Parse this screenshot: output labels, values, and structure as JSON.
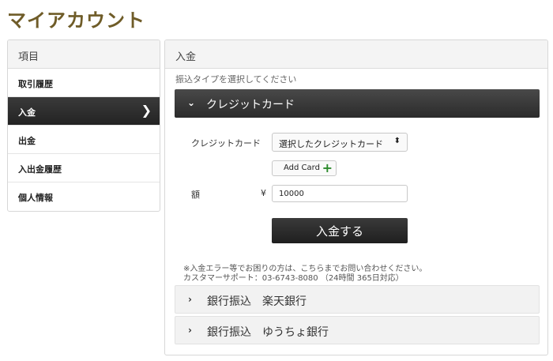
{
  "page": {
    "title": "マイアカウント"
  },
  "sidebar": {
    "header": "項目",
    "items": [
      {
        "label": "取引履歴"
      },
      {
        "label": "入金",
        "chevron": "❯"
      },
      {
        "label": "出金"
      },
      {
        "label": "入出金履歴"
      },
      {
        "label": "個人情報"
      }
    ]
  },
  "main": {
    "header": "入金",
    "hint": "振込タイプを選択してください",
    "credit_section": {
      "icon": "⌄",
      "label": "クレジットカード",
      "card_label": "クレジットカード",
      "card_select_value": "選択したクレジットカード",
      "select_arrow": "⬍",
      "add_card_label": "Add Card",
      "add_card_icon": "+",
      "amount_label": "額",
      "currency": "¥",
      "amount_value": "10000",
      "submit_label": "入金する"
    },
    "notice_line1": "※入金エラー等でお困りの方は、こちらまでお問い合わせください。",
    "notice_line2": "カスタマーサポート：03-6743-8080 （24時間 365日対応）",
    "bank_sections": [
      {
        "icon": "›",
        "label": "銀行振込　楽天銀行"
      },
      {
        "icon": "›",
        "label": "銀行振込　ゆうちょ銀行"
      }
    ]
  }
}
